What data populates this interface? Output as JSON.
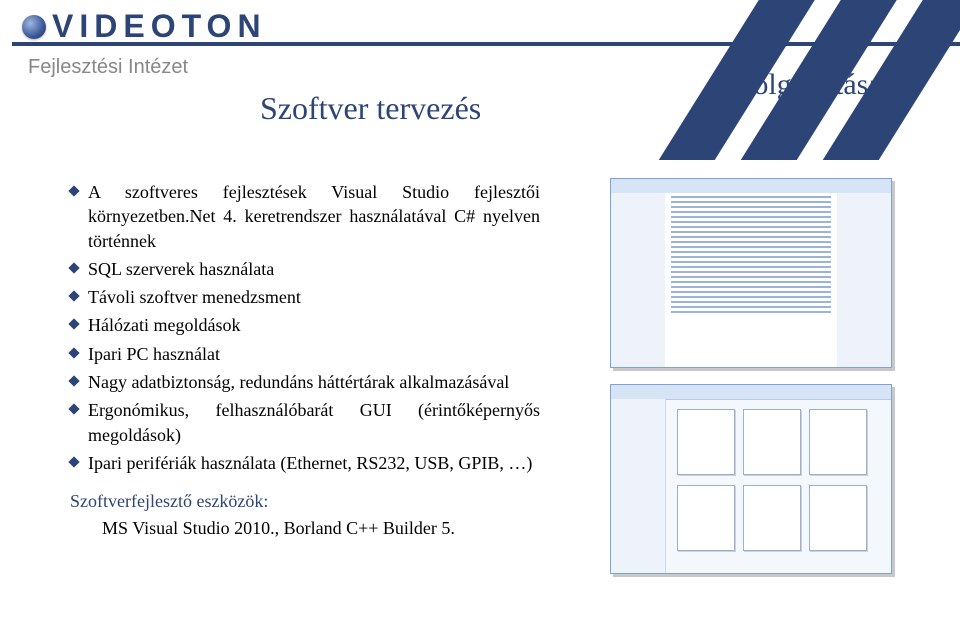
{
  "brand": {
    "logo_text": "VIDEOTON",
    "subtitle": "Fejlesztési Intézet"
  },
  "section_label": "Szolgáltatásaink",
  "page_title": "Szoftver tervezés",
  "bullets": [
    "A szoftveres fejlesztések Visual Studio fejlesztői környezetben.Net 4. keretrendszer használatával C# nyelven történnek",
    "SQL szerverek használata",
    "Távoli szoftver menedzsment",
    "Hálózati megoldások",
    "Ipari PC használat",
    "Nagy adatbiztonság, redundáns háttértárak alkalmazásával",
    "Ergonómikus, felhasználóbarát GUI (érintőképernyős megoldások)",
    "Ipari perifériák használata (Ethernet, RS232, USB, GPIB, …)"
  ],
  "tools": {
    "label": "Szoftverfejlesztő eszközök:",
    "value": "MS Visual Studio 2010., Borland C++ Builder 5."
  }
}
